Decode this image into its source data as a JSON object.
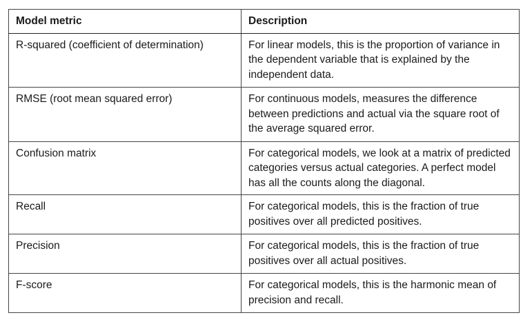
{
  "table": {
    "headers": {
      "metric": "Model metric",
      "description": "Description"
    },
    "rows": [
      {
        "metric": "R-squared (coefficient of determination)",
        "description": "For linear models, this is the proportion of variance in the dependent variable that is explained by the independent data."
      },
      {
        "metric": "RMSE (root mean squared error)",
        "description": "For continuous models, measures the difference between predictions and actual via the square root of the average squared error."
      },
      {
        "metric": "Confusion matrix",
        "description": "For categorical models, we look at a matrix of predicted categories versus actual categories. A perfect model has all the counts along the diagonal."
      },
      {
        "metric": "Recall",
        "description": "For categorical models, this is the fraction of true positives over all predicted positives."
      },
      {
        "metric": "Precision",
        "description": "For categorical models, this is the fraction of true positives over all actual positives."
      },
      {
        "metric": "F-score",
        "description": "For categorical models, this is the harmonic mean of precision and recall."
      }
    ]
  }
}
